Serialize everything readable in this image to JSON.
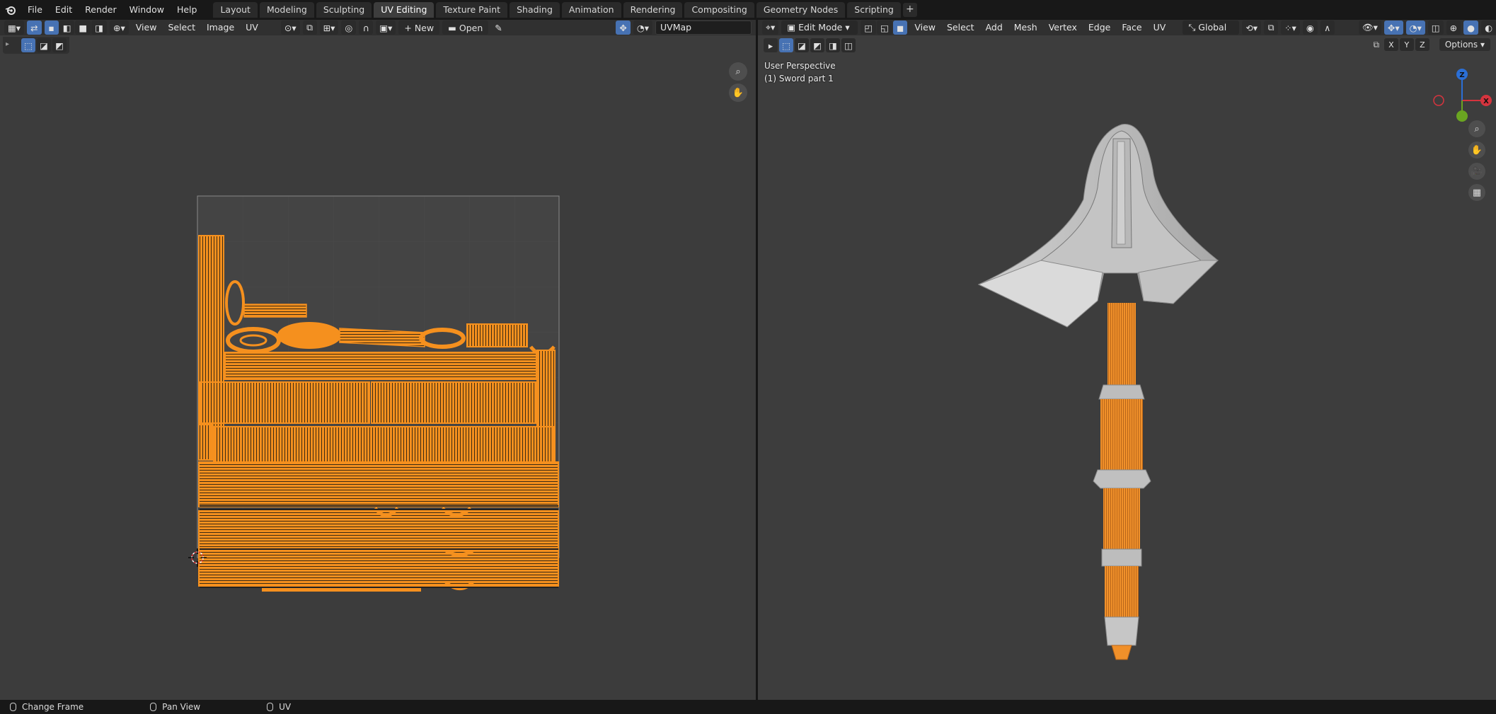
{
  "app": {
    "menus": [
      "File",
      "Edit",
      "Render",
      "Window",
      "Help"
    ],
    "workspace_tabs": [
      "Layout",
      "Modeling",
      "Sculpting",
      "UV Editing",
      "Texture Paint",
      "Shading",
      "Animation",
      "Rendering",
      "Compositing",
      "Geometry Nodes",
      "Scripting"
    ],
    "active_tab": "UV Editing"
  },
  "uv_editor": {
    "menus": [
      "View",
      "Select",
      "Image",
      "UV"
    ],
    "new_label": "New",
    "open_label": "Open",
    "uvmap_name": "UVMap"
  },
  "viewport": {
    "mode": "Edit Mode",
    "menus": [
      "View",
      "Select",
      "Add",
      "Mesh",
      "Vertex",
      "Edge",
      "Face",
      "UV"
    ],
    "transform_orientation": "Global",
    "axis_buttons": [
      "X",
      "Y",
      "Z"
    ],
    "options_label": "Options",
    "perspective_label": "User Perspective",
    "object_label": "(1) Sword part 1",
    "gizmo": {
      "z": "Z",
      "x": "X"
    }
  },
  "statusbar": {
    "items": [
      "Change Frame",
      "Pan View",
      "UV"
    ]
  },
  "colors": {
    "selected_orange": "#f5901e",
    "header_bg": "#303030",
    "active_blue": "#4772b3"
  }
}
